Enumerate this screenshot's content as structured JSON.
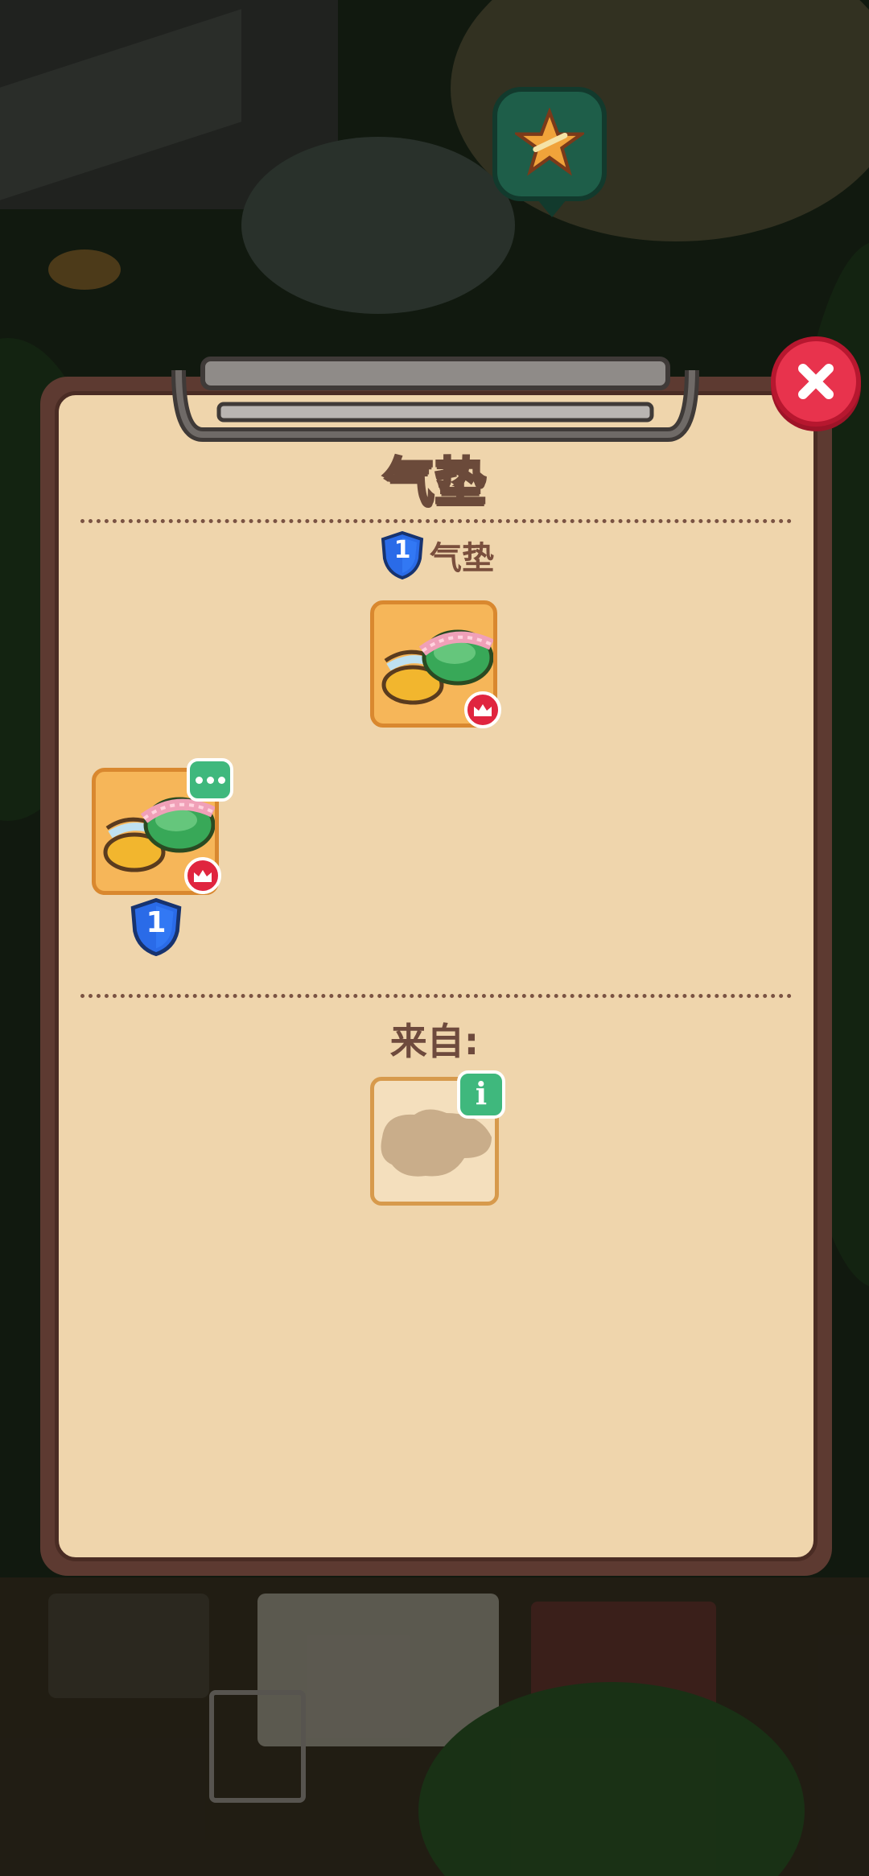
{
  "dialog": {
    "title": "气垫",
    "subtitle_level": "1",
    "subtitle_label": "气垫",
    "item_level": "1",
    "from_label": "来自:",
    "info_icon_text": "i"
  },
  "icons": {
    "close": "close-icon",
    "star": "star-icon",
    "crown": "crown-icon",
    "more": "more-options-icon",
    "info": "info-icon",
    "shield": "level-shield-icon"
  },
  "colors": {
    "panel_bg": "#efd5ac",
    "panel_border": "#5d3a31",
    "close_red": "#e8334d",
    "card_orange": "#f6b659",
    "badge_green": "#3fb87d",
    "shield_blue": "#2a6be8"
  }
}
